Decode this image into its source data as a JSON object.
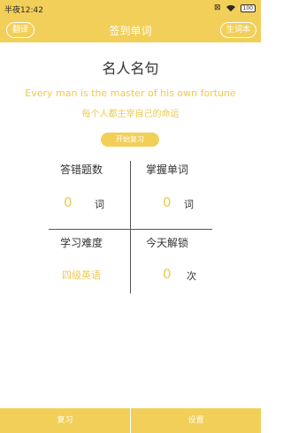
{
  "status_bar": {
    "time": "半夜12:42",
    "battery": "100"
  },
  "nav": {
    "left_button": "翻译",
    "title": "签到单词",
    "right_button": "生词本"
  },
  "main": {
    "title": "名人名句",
    "quote_en": "Every man is the master of his own  fortune",
    "quote_cn": "每个人都主宰自己的命运",
    "start_button": "开始复习"
  },
  "stats": {
    "wrong_label": "答错题数",
    "wrong_value": "0",
    "wrong_unit": "词",
    "mastered_label": "掌握单词",
    "mastered_value": "0",
    "mastered_unit": "词",
    "difficulty_label": "学习难度",
    "difficulty_value": "四级英语",
    "unlock_label": "今天解锁",
    "unlock_value": "0",
    "unlock_unit": "次"
  },
  "bottom": {
    "review": "复习",
    "settings": "设置"
  },
  "colors": {
    "accent": "#f2cf58",
    "accent_text": "#f0c84a"
  }
}
